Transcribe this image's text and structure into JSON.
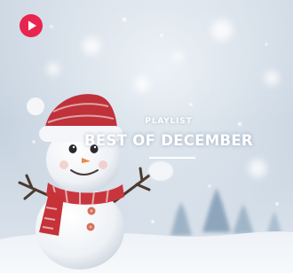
{
  "cover": {
    "eyebrow": "PLAYLIST",
    "title": "BEST OF DECEMBER"
  },
  "play_button": {
    "icon": "play-icon",
    "color": "#e8254f"
  },
  "artwork": {
    "subject": "snowman-in-snow",
    "hat_color": "#c0313a",
    "scarf_color": "#c9353c"
  }
}
